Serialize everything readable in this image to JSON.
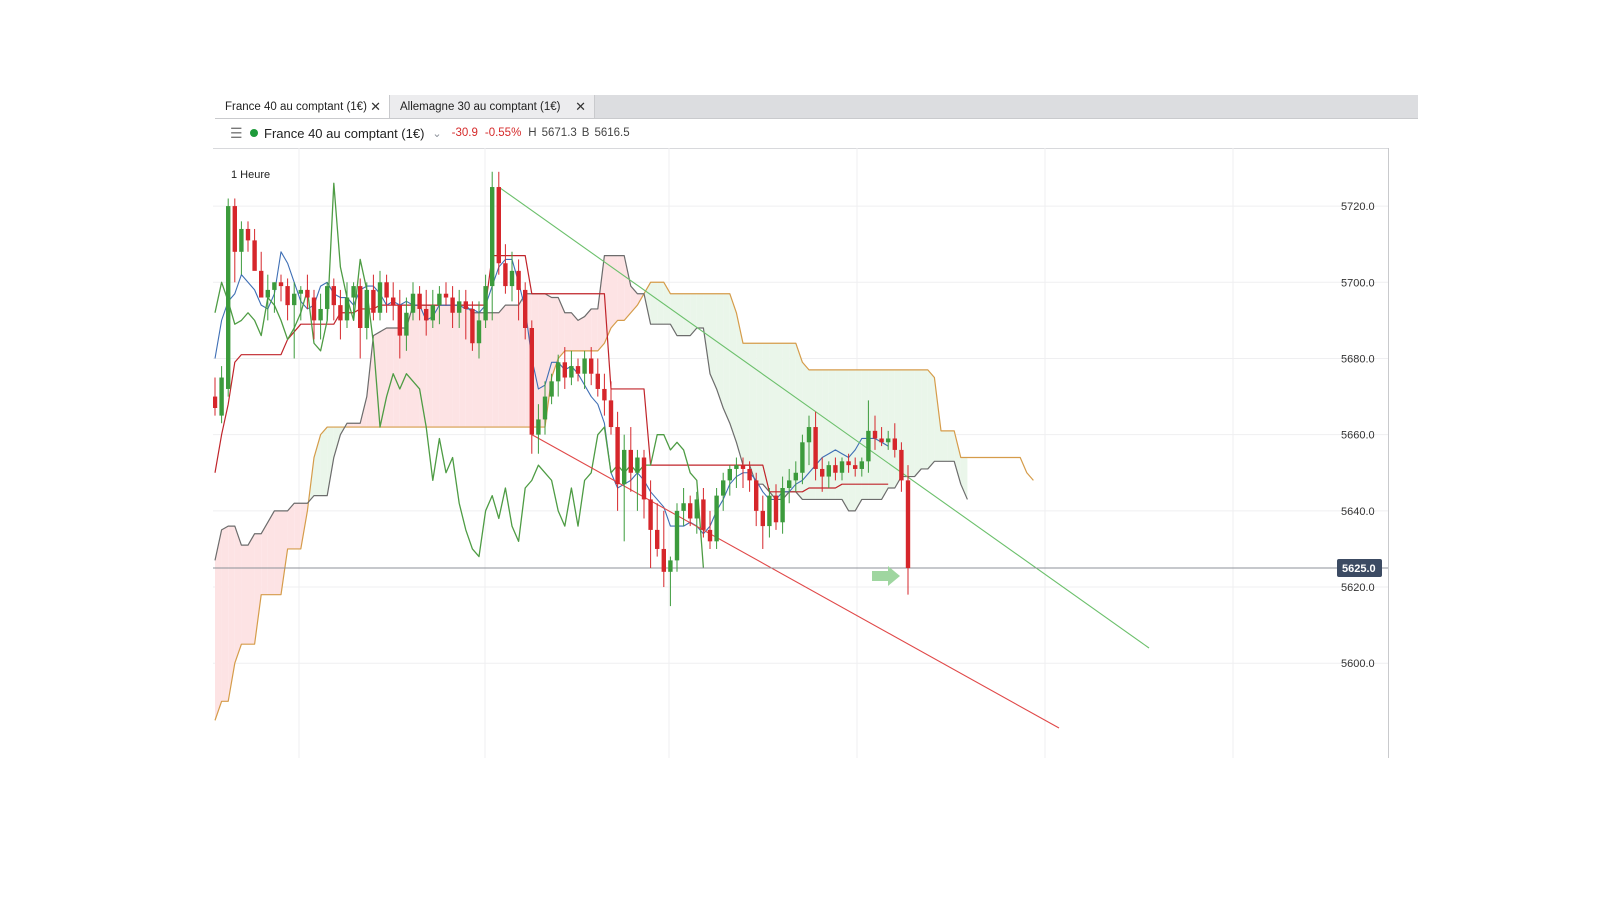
{
  "tabs": [
    {
      "label": "France 40 au comptant (1€)",
      "close": "✕",
      "active": true
    },
    {
      "label": "Allemagne 30 au comptant (1€)",
      "close": "✕",
      "active": false
    }
  ],
  "header": {
    "menu_icon": "hamburger-menu-icon",
    "status_color": "#1d9a3a",
    "instrument": "France 40 au comptant (1€)",
    "dropdown_icon": "chevron-down-icon",
    "change": "-30.9",
    "change_pct": "-0.55%",
    "high_label": "H",
    "high": "5671.3",
    "bid_label": "B",
    "bid": "5616.5"
  },
  "chart_data": {
    "type": "candlestick",
    "timeframe": "1 Heure",
    "ylim": [
      5583,
      5730
    ],
    "yticks": [
      5600,
      5620,
      5640,
      5660,
      5680,
      5700,
      5720
    ],
    "ytick_labels": [
      "5600.0",
      "5620.0",
      "5640.0",
      "5660.0",
      "5680.0",
      "5700.0",
      "5720.0"
    ],
    "current_price": 5625.0,
    "current_price_label": "5625.0",
    "colors": {
      "up": "#3c9b3c",
      "down": "#d6262b",
      "tenkan": "#3f6fb5",
      "kijun": "#c0242a",
      "chikou": "#4e9c44",
      "senkou_a": "#d59c4a",
      "senkou_b": "#6c6c6c",
      "cloud_bull": "#eaf6ea",
      "cloud_bear": "#fde3e4",
      "trend_upper": "#6cc06c",
      "trend_lower": "#e04848"
    },
    "candles": [
      [
        5670,
        5675,
        5665,
        5667
      ],
      [
        5665,
        5678,
        5663,
        5675
      ],
      [
        5672,
        5722,
        5670,
        5720
      ],
      [
        5720,
        5722,
        5700,
        5708
      ],
      [
        5708,
        5716,
        5702,
        5714
      ],
      [
        5714,
        5716,
        5708,
        5711
      ],
      [
        5711,
        5714,
        5705,
        5703
      ],
      [
        5703,
        5708,
        5698,
        5696
      ],
      [
        5696,
        5702,
        5690,
        5698
      ],
      [
        5698,
        5700,
        5692,
        5700
      ],
      [
        5700,
        5702,
        5695,
        5699
      ],
      [
        5699,
        5701,
        5690,
        5694
      ],
      [
        5694,
        5700,
        5680,
        5697
      ],
      [
        5697,
        5699,
        5690,
        5698
      ],
      [
        5698,
        5702,
        5693,
        5696
      ],
      [
        5696,
        5698,
        5685,
        5690
      ],
      [
        5690,
        5697,
        5685,
        5693
      ],
      [
        5693,
        5700,
        5690,
        5699
      ],
      [
        5699,
        5701,
        5690,
        5694
      ],
      [
        5694,
        5698,
        5685,
        5690
      ],
      [
        5690,
        5700,
        5688,
        5696
      ],
      [
        5696,
        5700,
        5690,
        5699
      ],
      [
        5699,
        5701,
        5680,
        5688
      ],
      [
        5688,
        5700,
        5685,
        5698
      ],
      [
        5698,
        5702,
        5690,
        5692
      ],
      [
        5692,
        5703,
        5690,
        5700
      ],
      [
        5700,
        5702,
        5692,
        5696
      ],
      [
        5696,
        5700,
        5690,
        5694
      ],
      [
        5694,
        5698,
        5680,
        5686
      ],
      [
        5686,
        5696,
        5682,
        5692
      ],
      [
        5692,
        5700,
        5690,
        5697
      ],
      [
        5697,
        5699,
        5690,
        5693
      ],
      [
        5693,
        5698,
        5686,
        5690
      ],
      [
        5690,
        5698,
        5688,
        5694
      ],
      [
        5694,
        5699,
        5689,
        5697
      ],
      [
        5697,
        5700,
        5694,
        5696
      ],
      [
        5696,
        5699,
        5688,
        5692
      ],
      [
        5692,
        5698,
        5688,
        5695
      ],
      [
        5695,
        5698,
        5685,
        5693
      ],
      [
        5693,
        5695,
        5682,
        5684
      ],
      [
        5684,
        5695,
        5680,
        5690
      ],
      [
        5690,
        5702,
        5688,
        5699
      ],
      [
        5699,
        5729,
        5690,
        5725
      ],
      [
        5725,
        5729,
        5702,
        5705
      ],
      [
        5705,
        5710,
        5697,
        5699
      ],
      [
        5699,
        5708,
        5695,
        5703
      ],
      [
        5703,
        5706,
        5690,
        5698
      ],
      [
        5698,
        5700,
        5685,
        5688
      ],
      [
        5688,
        5690,
        5655,
        5660
      ],
      [
        5660,
        5668,
        5655,
        5664
      ],
      [
        5664,
        5674,
        5660,
        5670
      ],
      [
        5670,
        5676,
        5668,
        5674
      ],
      [
        5674,
        5681,
        5670,
        5679
      ],
      [
        5679,
        5683,
        5672,
        5675
      ],
      [
        5675,
        5682,
        5673,
        5678
      ],
      [
        5678,
        5680,
        5674,
        5676
      ],
      [
        5676,
        5682,
        5672,
        5680
      ],
      [
        5680,
        5683,
        5673,
        5676
      ],
      [
        5676,
        5680,
        5670,
        5672
      ],
      [
        5672,
        5676,
        5665,
        5669
      ],
      [
        5669,
        5674,
        5660,
        5662
      ],
      [
        5662,
        5666,
        5640,
        5647
      ],
      [
        5647,
        5660,
        5632,
        5656
      ],
      [
        5656,
        5662,
        5645,
        5650
      ],
      [
        5650,
        5656,
        5640,
        5654
      ],
      [
        5654,
        5656,
        5638,
        5643
      ],
      [
        5643,
        5648,
        5625,
        5635
      ],
      [
        5635,
        5642,
        5628,
        5630
      ],
      [
        5630,
        5640,
        5620,
        5624
      ],
      [
        5624,
        5628,
        5615,
        5627
      ],
      [
        5627,
        5642,
        5624,
        5640
      ],
      [
        5640,
        5646,
        5636,
        5642
      ],
      [
        5642,
        5644,
        5636,
        5638
      ],
      [
        5638,
        5645,
        5634,
        5643
      ],
      [
        5643,
        5646,
        5633,
        5635
      ],
      [
        5635,
        5640,
        5630,
        5632
      ],
      [
        5632,
        5646,
        5630,
        5644
      ],
      [
        5644,
        5650,
        5640,
        5648
      ],
      [
        5648,
        5652,
        5644,
        5651
      ],
      [
        5651,
        5654,
        5646,
        5652
      ],
      [
        5652,
        5654,
        5646,
        5651
      ],
      [
        5651,
        5653,
        5645,
        5648
      ],
      [
        5648,
        5650,
        5636,
        5640
      ],
      [
        5640,
        5644,
        5630,
        5636
      ],
      [
        5636,
        5646,
        5633,
        5644
      ],
      [
        5644,
        5647,
        5635,
        5637
      ],
      [
        5637,
        5649,
        5634,
        5646
      ],
      [
        5646,
        5651,
        5642,
        5648
      ],
      [
        5648,
        5653,
        5645,
        5650
      ],
      [
        5650,
        5660,
        5647,
        5658
      ],
      [
        5658,
        5665,
        5652,
        5662
      ],
      [
        5662,
        5666,
        5648,
        5651
      ],
      [
        5651,
        5654,
        5645,
        5649
      ],
      [
        5649,
        5653,
        5646,
        5652
      ],
      [
        5652,
        5654,
        5648,
        5650
      ],
      [
        5650,
        5654,
        5648,
        5653
      ],
      [
        5653,
        5655,
        5650,
        5652
      ],
      [
        5652,
        5654,
        5649,
        5651
      ],
      [
        5651,
        5654,
        5649,
        5653
      ],
      [
        5653,
        5669,
        5650,
        5661
      ],
      [
        5661,
        5665,
        5656,
        5659
      ],
      [
        5659,
        5662,
        5657,
        5658
      ],
      [
        5658,
        5661,
        5656,
        5659
      ],
      [
        5659,
        5663,
        5654,
        5656
      ],
      [
        5656,
        5658,
        5645,
        5648
      ],
      [
        5648,
        5652,
        5618,
        5625
      ]
    ],
    "tenkan": [
      5680,
      5690,
      5695,
      5697,
      5702,
      5700,
      5698,
      5694,
      5693,
      5697,
      5708,
      5705,
      5700,
      5695,
      5693,
      5694,
      5699,
      5700,
      5697,
      5696,
      5696,
      5694,
      5698,
      5699,
      5699,
      5697,
      5694,
      5695,
      5694,
      5695,
      5694,
      5694,
      5690,
      5691,
      5694,
      5694,
      5694,
      5694,
      5693,
      5693,
      5692,
      5694,
      5699,
      5704,
      5706,
      5706,
      5700,
      5693,
      5680,
      5672,
      5673,
      5679,
      5679,
      5677,
      5678,
      5676,
      5673,
      5670,
      5668,
      5663,
      5650,
      5646,
      5647,
      5648,
      5650,
      5648,
      5645,
      5643,
      5641,
      5636,
      5636,
      5636,
      5637,
      5636,
      5634,
      5636,
      5640,
      5643,
      5647,
      5649,
      5650,
      5650,
      5648,
      5645,
      5643,
      5643,
      5645,
      5645,
      5647,
      5648,
      5650,
      5652,
      5654,
      5655,
      5656,
      5655,
      5654,
      5656,
      5659,
      5659,
      5659,
      5658,
      5657
    ],
    "kijun": [
      5650,
      5660,
      5668,
      5679,
      5681,
      5681,
      5681,
      5681,
      5681,
      5681,
      5681,
      5685,
      5687,
      5689,
      5689,
      5689,
      5689,
      5689,
      5689,
      5692,
      5692,
      5692,
      5693,
      5693,
      5693,
      5694,
      5694,
      5694,
      5694,
      5694,
      5694,
      5694,
      5694,
      5694,
      5694,
      5694,
      5694,
      5694,
      5694,
      5694,
      5694,
      5694,
      5707,
      5707,
      5707,
      5707,
      5707,
      5707,
      5697,
      5697,
      5697,
      5697,
      5697,
      5697,
      5697,
      5697,
      5697,
      5697,
      5697,
      5697,
      5672,
      5672,
      5672,
      5672,
      5672,
      5672,
      5652,
      5652,
      5652,
      5652,
      5652,
      5652,
      5652,
      5652,
      5652,
      5652,
      5652,
      5652,
      5652,
      5652,
      5652,
      5652,
      5652,
      5652,
      5645,
      5645,
      5645,
      5645,
      5645,
      5645,
      5646,
      5646,
      5646,
      5646,
      5646,
      5647,
      5647,
      5647,
      5647,
      5647,
      5647,
      5647,
      5647
    ],
    "chikou": [
      5692,
      5700,
      5695,
      5689,
      5690,
      5692,
      5690,
      5686,
      5696,
      5694,
      5690,
      5685,
      5688,
      5692,
      5698,
      5684,
      5682,
      5690,
      5726,
      5704,
      5696,
      5690,
      5706,
      5698,
      5684,
      5662,
      5670,
      5676,
      5672,
      5676,
      5674,
      5672,
      5662,
      5648,
      5659,
      5650,
      5654,
      5642,
      5635,
      5630,
      5628,
      5640,
      5644,
      5638,
      5646,
      5636,
      5632,
      5646,
      5648,
      5652,
      5650,
      5648,
      5640,
      5636,
      5646,
      5636,
      5648,
      5650,
      5660,
      5662,
      5650,
      5652,
      5650,
      5652,
      5650,
      5652,
      5652,
      5660,
      5660,
      5656,
      5658,
      5656,
      5650,
      5648,
      5625
    ],
    "senkou_a": [
      5585,
      5590,
      5590,
      5600,
      5605,
      5605,
      5605,
      5618,
      5618,
      5618,
      5618,
      5630,
      5630,
      5630,
      5640,
      5654,
      5660,
      5662,
      5662,
      5662,
      5662,
      5662,
      5662,
      5662,
      5662,
      5662,
      5662,
      5662,
      5662,
      5662,
      5662,
      5662,
      5662,
      5662,
      5662,
      5662,
      5662,
      5662,
      5662,
      5662,
      5662,
      5662,
      5662,
      5662,
      5662,
      5662,
      5662,
      5662,
      5662,
      5662,
      5662,
      5675,
      5680,
      5682,
      5682,
      5682,
      5682,
      5682,
      5682,
      5684,
      5688,
      5690,
      5690,
      5692,
      5694,
      5697,
      5700,
      5700,
      5700,
      5697,
      5697,
      5697,
      5697,
      5697,
      5697,
      5697,
      5697,
      5697,
      5697,
      5692,
      5684,
      5684,
      5684,
      5684,
      5684,
      5684,
      5684,
      5684,
      5684,
      5679,
      5677,
      5677,
      5677,
      5677,
      5677,
      5677,
      5677,
      5677,
      5677,
      5677,
      5677,
      5677,
      5677,
      5677,
      5677,
      5677,
      5677,
      5677,
      5677,
      5675,
      5661,
      5661,
      5661,
      5654,
      5654,
      5654,
      5654,
      5654,
      5654,
      5654,
      5654,
      5654,
      5654,
      5650,
      5648
    ],
    "senkou_b": [
      5627,
      5635,
      5636,
      5636,
      5631,
      5631,
      5634,
      5634,
      5637,
      5640,
      5640,
      5640,
      5642,
      5642,
      5642,
      5644,
      5644,
      5644,
      5654,
      5660,
      5663,
      5663,
      5663,
      5670,
      5686,
      5687,
      5688,
      5688,
      5688,
      5688,
      5694,
      5694,
      5694,
      5694,
      5694,
      5694,
      5694,
      5694,
      5694,
      5692,
      5692,
      5692,
      5692,
      5692,
      5694,
      5694,
      5694,
      5697,
      5697,
      5697,
      5697,
      5696,
      5696,
      5692,
      5692,
      5690,
      5691,
      5693,
      5693,
      5707,
      5707,
      5707,
      5707,
      5699,
      5697,
      5697,
      5689,
      5689,
      5689,
      5689,
      5686,
      5686,
      5686,
      5688,
      5688,
      5676,
      5672,
      5667,
      5663,
      5658,
      5652,
      5652,
      5647,
      5647,
      5645,
      5643,
      5643,
      5645,
      5645,
      5643,
      5643,
      5643,
      5643,
      5643,
      5643,
      5643,
      5640,
      5640,
      5643,
      5643,
      5643,
      5643,
      5646,
      5646,
      5649,
      5649,
      5649,
      5651,
      5651,
      5653,
      5653,
      5653,
      5653,
      5647,
      5643
    ]
  }
}
